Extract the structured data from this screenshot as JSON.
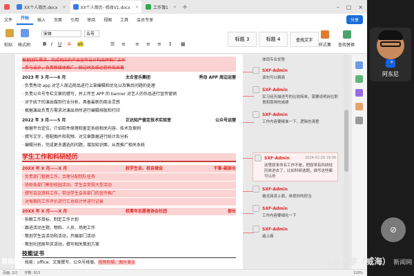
{
  "tabs": [
    {
      "label": "XX个人简历.docx",
      "color": "#3b7be6",
      "active": false
    },
    {
      "label": "XX个人简历- 修改V1.docx",
      "color": "#3b7be6",
      "active": true
    },
    {
      "label": "工作簿1",
      "color": "#2fa84f",
      "active": false
    }
  ],
  "menu": [
    "文件",
    "开始",
    "插入",
    "页面",
    "引用",
    "审阅",
    "视图",
    "工具",
    "会员专享"
  ],
  "menu_active_index": 1,
  "share_label": "分享",
  "ribbon": {
    "font_name": "宋体",
    "font_size": "五号",
    "styles": [
      "标题 3",
      "标题 4",
      "查找文字"
    ],
    "labels": {
      "paste": "粘贴",
      "format_painter": "格式刷",
      "styles_group": "样式集",
      "find_replace": "查找替换"
    }
  },
  "document": {
    "lines": [
      {
        "text": "根据团队需求，完成相应的产品宣传设计和品牌推广工作",
        "type": "del"
      },
      {
        "text": "· 参与设计，负责新媒体推广，聊过时及维运营有效显著",
        "type": "del"
      },
      {
        "left": "2023 年 3 月——6 月",
        "mid": "太合音乐集团",
        "right": "秀动 APP 周边运营",
        "type": "job"
      },
      {
        "text": "· 负责秀动 app 对艺人周边商品进行上架编辑和优化以及售后问题的处理"
      },
      {
        "text": "· 负责公众号专栏文章的撰写，并上传至 APP 的 banner 对艺人的作品进行宣传营销"
      },
      {
        "text": "· 对于线下的演出做到行业分析，具备最新的商业灵感"
      },
      {
        "text": "· 根据演出负责方需求对演出场所进行编辑排版和打印"
      },
      {
        "left": "2022 年 3 月——5 月",
        "mid": "正达知产鉴定技术实验室",
        "right": "公众号运营",
        "type": "job"
      },
      {
        "text": "· 根据平台定位，介绍软件原理和鉴定系统相关内容、技术及案例"
      },
      {
        "text": "· 撰写文字，搭配图片和视频、对文章数据进行统计及分析"
      },
      {
        "text": "· 编辑分析，完成更多遴选的问题，增加知识面，从而推广相关系统"
      }
    ],
    "section1": "学生工作和科研经历",
    "lines2": [
      {
        "left": "20XX 年 X 月——X 月",
        "mid": "校学生会、校自律会",
        "right": "干事-副部长",
        "type": "jobred"
      },
      {
        "text": "· 负责部门管理工作，合理分配院队任务",
        "type": "hl"
      },
      {
        "text": "· 协助各部门筹划校园活动、学生会常规大型活动",
        "type": "hl"
      },
      {
        "text": "· 撰写会议资料工作，带动学生会各部门的宣传推广",
        "type": "hl"
      },
      {
        "text": "· 对每期的工作评价进行汇总统计并进行记录",
        "type": "hl"
      },
      {
        "left": "20XX 年 X 月——X 月",
        "mid": "校青年志愿者协会社团",
        "right": "部长",
        "type": "jobred"
      },
      {
        "text": "· 拆解工作目标、制定工作计划"
      },
      {
        "text": "· 跟进活动主题、物料、人员、场地工作"
      },
      {
        "text": "· 策划学生会活动和活动，开展部门活动"
      },
      {
        "text": "· 策划社团周年庆活动，撰写相关策划方案"
      }
    ],
    "section2": "技能证书",
    "skills_prefix": "· 技能：office、文案撰写、公众号排版、",
    "skills_hl": "视频剪辑、图片美化"
  },
  "comments": [
    {
      "author": "",
      "date": "",
      "body": "体现专业优势"
    },
    {
      "author": "SXF-Admin",
      "date": "",
      "body": "该句可以精简"
    },
    {
      "author": "SXF-Admin",
      "date": "",
      "body": "实习经历描述写的比较简单，需要说明岗位职责和取得的成绩"
    },
    {
      "author": "SXF-Admin",
      "date": "",
      "body": "工作内容要精准一下，逻辑也清楚"
    },
    {
      "author": "SXF-Admin",
      "date": "2024-02-20 19:00",
      "body": "这里原来命名工作不是，把原来有科研经历放进去了，比如科研选题，描写这些都可以的",
      "active": true
    },
    {
      "author": "SXF-Admin",
      "date": "",
      "body": "格式阅读上面，体现你的担当"
    },
    {
      "author": "SXF-Admin",
      "date": "",
      "body": "工作内容要细化一下"
    },
    {
      "author": "SXF-Admin",
      "date": "",
      "body": "遍上面"
    }
  ],
  "statusbar": {
    "page": "页面: 2/2",
    "words": "字数: 913",
    "zoom": "120%"
  },
  "participant": {
    "name": "阿东尼"
  },
  "watermark": {
    "main": "山东大学（威海）",
    "sub": "新闻网"
  },
  "channel_logo": "易扬霖"
}
